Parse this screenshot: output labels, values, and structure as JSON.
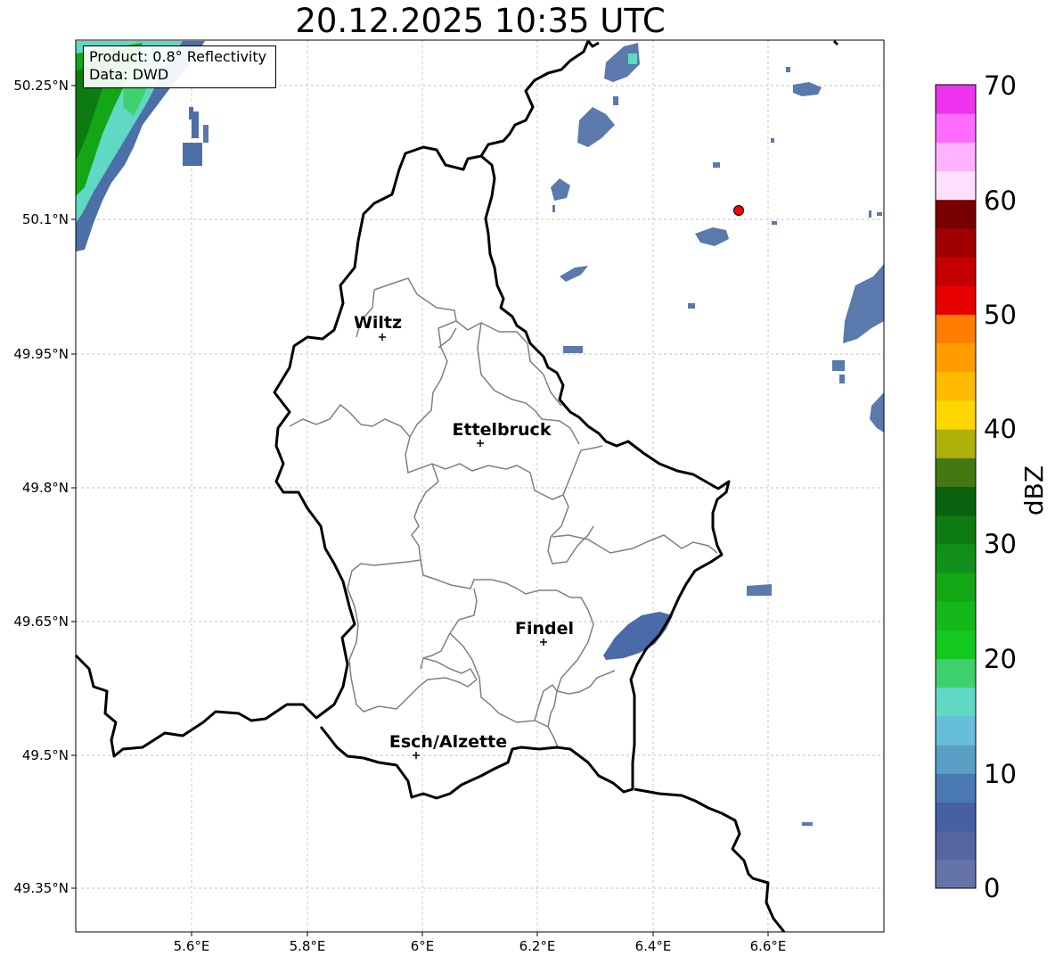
{
  "title": "20.12.2025 10:35 UTC",
  "info": {
    "product": "Product: 0.8° Reflectivity",
    "source": "Data: DWD"
  },
  "axes": {
    "x_ticks": [
      "5.6°E",
      "5.8°E",
      "6°E",
      "6.2°E",
      "6.4°E",
      "6.6°E"
    ],
    "y_ticks": [
      "50.25°N",
      "50.1°N",
      "49.95°N",
      "49.8°N",
      "49.65°N",
      "49.5°N",
      "49.35°N"
    ]
  },
  "cities": [
    {
      "name": "Wiltz"
    },
    {
      "name": "Ettelbruck"
    },
    {
      "name": "Findel"
    },
    {
      "name": "Esch/Alzette"
    }
  ],
  "colorbar": {
    "label": "dBZ",
    "ticks": [
      "0",
      "10",
      "20",
      "30",
      "40",
      "50",
      "60",
      "70"
    ],
    "colors": [
      "#6474a8",
      "#5566a0",
      "#4760a2",
      "#4a79b2",
      "#5a9ec6",
      "#66bedb",
      "#5fd8c4",
      "#3fd06e",
      "#13c81f",
      "#14b81a",
      "#13a716",
      "#10901a",
      "#0e7a12",
      "#09600e",
      "#447812",
      "#b0b00a",
      "#ffd700",
      "#ffbb00",
      "#ff9d00",
      "#ff7d00",
      "#e80000",
      "#c60000",
      "#a00000",
      "#780000",
      "#ffdfff",
      "#ffb2ff",
      "#ff6bff",
      "#ee33ee"
    ]
  },
  "radar_marker": {
    "color": "#ff0000"
  }
}
